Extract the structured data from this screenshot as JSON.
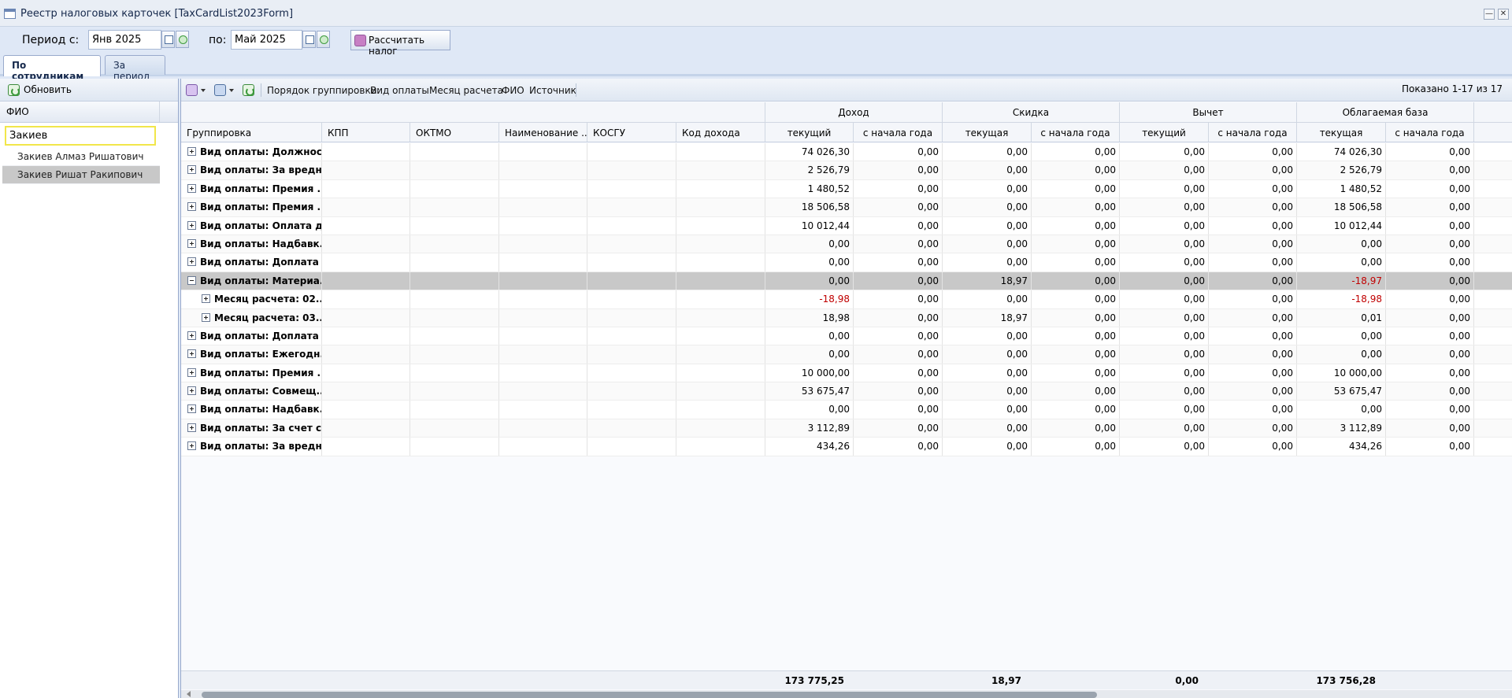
{
  "window": {
    "title": "Реестр налоговых карточек [TaxCardList2023Form]"
  },
  "period": {
    "from_label": "Период с:",
    "from_value": "Янв 2025",
    "to_label": "по:",
    "to_value": "Май 2025",
    "calc_button": "Рассчитать налог"
  },
  "tabs": [
    {
      "label": "По сотрудникам",
      "active": true
    },
    {
      "label": "За период",
      "active": false
    }
  ],
  "left_panel": {
    "refresh_label": "Обновить",
    "column_header": "ФИО",
    "filter_value": "Закиев",
    "employees": [
      {
        "name": "Закиев Алмаз Ришатович",
        "selected": false
      },
      {
        "name": "Закиев Ришат Ракипович",
        "selected": true
      }
    ]
  },
  "grid": {
    "toolbar": {
      "grouping_label": "Порядок группировки:",
      "grouping_fields": [
        "Вид оплаты",
        "Месяц расчета",
        "ФИО",
        "Источник"
      ],
      "shown_text": "Показано 1-17 из 17"
    },
    "group_headers": [
      "Доход",
      "Скидка",
      "Вычет",
      "Облагаемая база"
    ],
    "columns": [
      "Группировка",
      "КПП",
      "ОКТМО",
      "Наименование ...",
      "КОСГУ",
      "Код дохода",
      "текущий",
      "с начала года",
      "текущая",
      "с начала года",
      "текущий",
      "с начала года",
      "текущая",
      "с начала года"
    ],
    "rows": [
      {
        "level": 0,
        "expanded": false,
        "label": "Вид оплаты: Должнос...",
        "values": [
          "74 026,30",
          "0,00",
          "0,00",
          "0,00",
          "0,00",
          "0,00",
          "74 026,30",
          "0,00"
        ]
      },
      {
        "level": 0,
        "expanded": false,
        "label": "Вид оплаты: За вредн...",
        "values": [
          "2 526,79",
          "0,00",
          "0,00",
          "0,00",
          "0,00",
          "0,00",
          "2 526,79",
          "0,00"
        ]
      },
      {
        "level": 0,
        "expanded": false,
        "label": "Вид оплаты: Премия ...",
        "values": [
          "1 480,52",
          "0,00",
          "0,00",
          "0,00",
          "0,00",
          "0,00",
          "1 480,52",
          "0,00"
        ]
      },
      {
        "level": 0,
        "expanded": false,
        "label": "Вид оплаты: Премия ...",
        "values": [
          "18 506,58",
          "0,00",
          "0,00",
          "0,00",
          "0,00",
          "0,00",
          "18 506,58",
          "0,00"
        ]
      },
      {
        "level": 0,
        "expanded": false,
        "label": "Вид оплаты: Оплата д...",
        "values": [
          "10 012,44",
          "0,00",
          "0,00",
          "0,00",
          "0,00",
          "0,00",
          "10 012,44",
          "0,00"
        ]
      },
      {
        "level": 0,
        "expanded": false,
        "label": "Вид оплаты: Надбавк...",
        "values": [
          "0,00",
          "0,00",
          "0,00",
          "0,00",
          "0,00",
          "0,00",
          "0,00",
          "0,00"
        ]
      },
      {
        "level": 0,
        "expanded": false,
        "label": "Вид оплаты: Доплата ...",
        "values": [
          "0,00",
          "0,00",
          "0,00",
          "0,00",
          "0,00",
          "0,00",
          "0,00",
          "0,00"
        ]
      },
      {
        "level": 0,
        "expanded": true,
        "selected": true,
        "label": "Вид оплаты: Материа...",
        "values": [
          "0,00",
          "0,00",
          "18,97",
          "0,00",
          "0,00",
          "0,00",
          "-18,97",
          "0,00"
        ]
      },
      {
        "level": 1,
        "expanded": false,
        "label": "Месяц расчета: 02....",
        "values": [
          "-18,98",
          "0,00",
          "0,00",
          "0,00",
          "0,00",
          "0,00",
          "-18,98",
          "0,00"
        ]
      },
      {
        "level": 1,
        "expanded": false,
        "label": "Месяц расчета: 03....",
        "values": [
          "18,98",
          "0,00",
          "18,97",
          "0,00",
          "0,00",
          "0,00",
          "0,01",
          "0,00"
        ]
      },
      {
        "level": 0,
        "expanded": false,
        "label": "Вид оплаты: Доплата ...",
        "values": [
          "0,00",
          "0,00",
          "0,00",
          "0,00",
          "0,00",
          "0,00",
          "0,00",
          "0,00"
        ]
      },
      {
        "level": 0,
        "expanded": false,
        "label": "Вид оплаты: Ежегодн...",
        "values": [
          "0,00",
          "0,00",
          "0,00",
          "0,00",
          "0,00",
          "0,00",
          "0,00",
          "0,00"
        ]
      },
      {
        "level": 0,
        "expanded": false,
        "label": "Вид оплаты: Премия ...",
        "values": [
          "10 000,00",
          "0,00",
          "0,00",
          "0,00",
          "0,00",
          "0,00",
          "10 000,00",
          "0,00"
        ]
      },
      {
        "level": 0,
        "expanded": false,
        "label": "Вид оплаты: Совмещ...",
        "values": [
          "53 675,47",
          "0,00",
          "0,00",
          "0,00",
          "0,00",
          "0,00",
          "53 675,47",
          "0,00"
        ]
      },
      {
        "level": 0,
        "expanded": false,
        "label": "Вид оплаты: Надбавк...",
        "values": [
          "0,00",
          "0,00",
          "0,00",
          "0,00",
          "0,00",
          "0,00",
          "0,00",
          "0,00"
        ]
      },
      {
        "level": 0,
        "expanded": false,
        "label": "Вид оплаты: За счет с...",
        "values": [
          "3 112,89",
          "0,00",
          "0,00",
          "0,00",
          "0,00",
          "0,00",
          "3 112,89",
          "0,00"
        ]
      },
      {
        "level": 0,
        "expanded": false,
        "label": "Вид оплаты: За вредн...",
        "values": [
          "434,26",
          "0,00",
          "0,00",
          "0,00",
          "0,00",
          "0,00",
          "434,26",
          "0,00"
        ]
      }
    ],
    "totals": {
      "income": "173 775,25",
      "discount": "18,97",
      "deduction": "0,00",
      "taxable_base": "173 756,28"
    }
  },
  "colors": {
    "negative": "#c00000",
    "selected_row": "#c8c8c8",
    "filter_border": "#f1e64a"
  }
}
